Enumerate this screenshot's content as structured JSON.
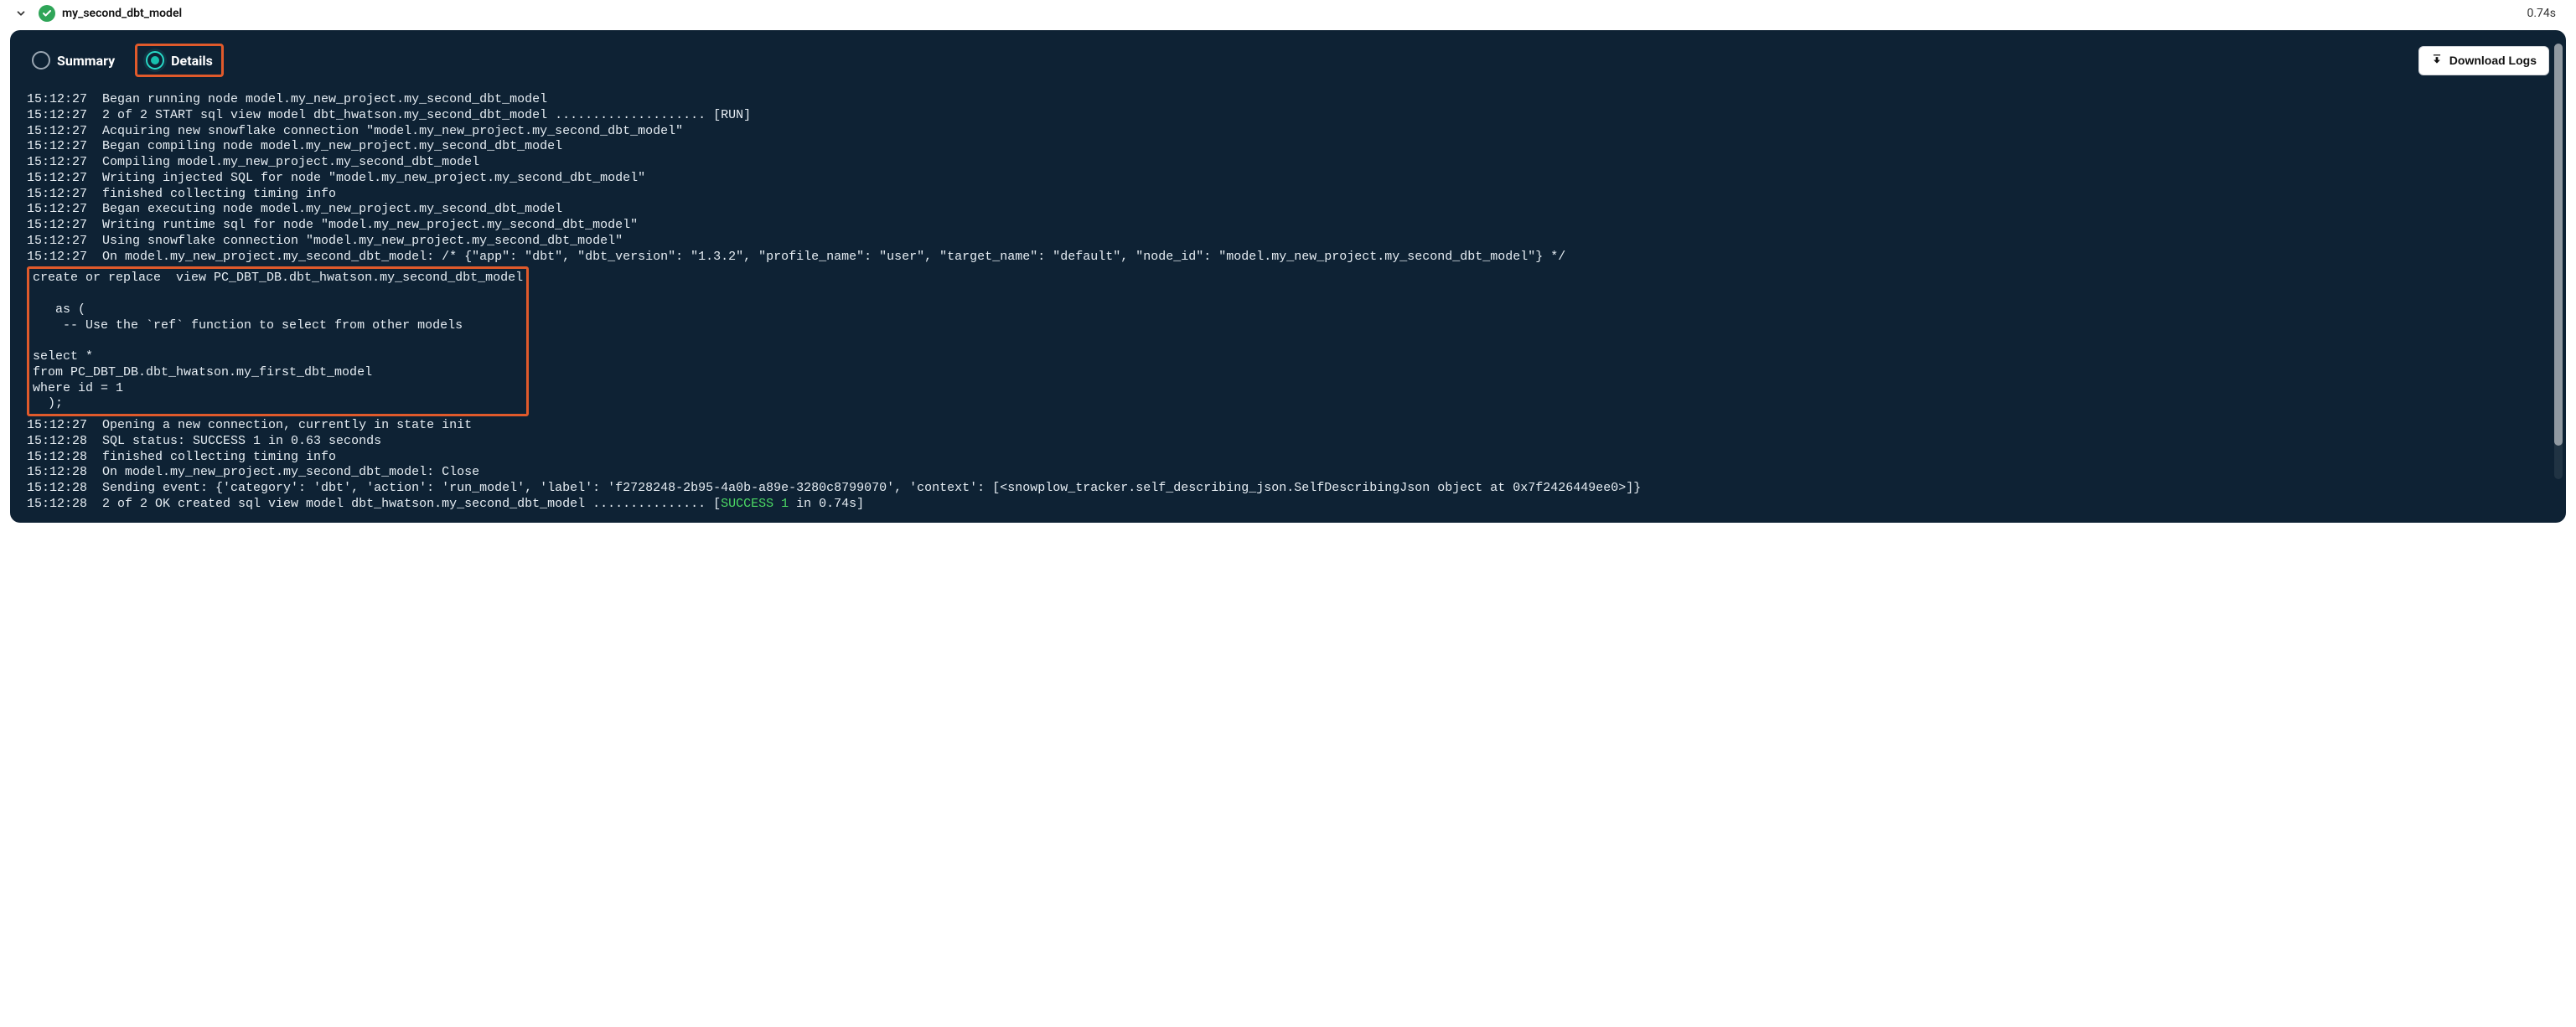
{
  "header": {
    "title": "my_second_dbt_model",
    "duration": "0.74s"
  },
  "tabs": {
    "summary_label": "Summary",
    "details_label": "Details"
  },
  "download_label": "Download Logs",
  "log_lines": [
    "15:12:27  Began running node model.my_new_project.my_second_dbt_model",
    "15:12:27  2 of 2 START sql view model dbt_hwatson.my_second_dbt_model .................... [RUN]",
    "15:12:27  Acquiring new snowflake connection \"model.my_new_project.my_second_dbt_model\"",
    "15:12:27  Began compiling node model.my_new_project.my_second_dbt_model",
    "15:12:27  Compiling model.my_new_project.my_second_dbt_model",
    "15:12:27  Writing injected SQL for node \"model.my_new_project.my_second_dbt_model\"",
    "15:12:27  finished collecting timing info",
    "15:12:27  Began executing node model.my_new_project.my_second_dbt_model",
    "15:12:27  Writing runtime sql for node \"model.my_new_project.my_second_dbt_model\"",
    "15:12:27  Using snowflake connection \"model.my_new_project.my_second_dbt_model\"",
    "15:12:27  On model.my_new_project.my_second_dbt_model: /* {\"app\": \"dbt\", \"dbt_version\": \"1.3.2\", \"profile_name\": \"user\", \"target_name\": \"default\", \"node_id\": \"model.my_new_project.my_second_dbt_model\"} */"
  ],
  "sql_block": "create or replace  view PC_DBT_DB.dbt_hwatson.my_second_dbt_model\n  \n   as (\n    -- Use the `ref` function to select from other models\n\nselect *\nfrom PC_DBT_DB.dbt_hwatson.my_first_dbt_model\nwhere id = 1\n  );",
  "log_lines_after": [
    "15:12:27  Opening a new connection, currently in state init",
    "15:12:28  SQL status: SUCCESS 1 in 0.63 seconds",
    "15:12:28  finished collecting timing info",
    "15:12:28  On model.my_new_project.my_second_dbt_model: Close",
    "15:12:28  Sending event: {'category': 'dbt', 'action': 'run_model', 'label': 'f2728248-2b95-4a0b-a89e-3280c8799070', 'context': [<snowplow_tracker.self_describing_json.SelfDescribingJson object at 0x7f2426449ee0>]}"
  ],
  "log_final_prefix": "15:12:28  2 of 2 OK created sql view model dbt_hwatson.my_second_dbt_model ............... [",
  "log_final_success": "SUCCESS 1",
  "log_final_suffix": " in 0.74s]"
}
